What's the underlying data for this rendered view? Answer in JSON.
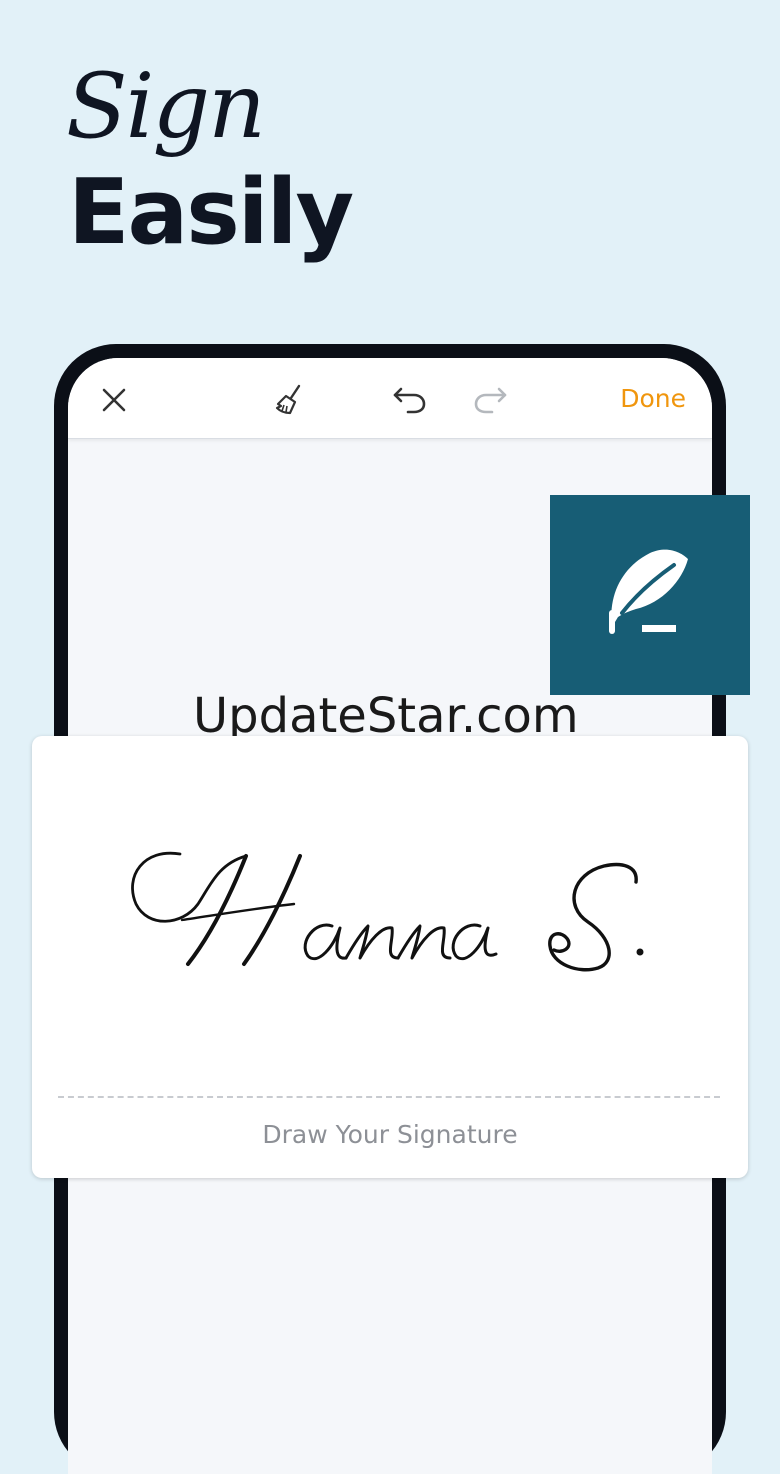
{
  "headline": {
    "line1": "Sign",
    "line2": "Easily"
  },
  "toolbar": {
    "close_icon": "close-icon",
    "clear_icon": "broom-icon",
    "undo_icon": "undo-icon",
    "redo_icon": "redo-icon",
    "done_label": "Done"
  },
  "badge": {
    "icon": "quill-icon",
    "color": "#175d75"
  },
  "watermark": "UpdateStar.com",
  "signature_pad": {
    "signature_text": "Hanna S.",
    "hint": "Draw Your Signature"
  },
  "colors": {
    "background": "#e2f1f8",
    "accent": "#f0960e",
    "frame": "#0b0f17"
  }
}
